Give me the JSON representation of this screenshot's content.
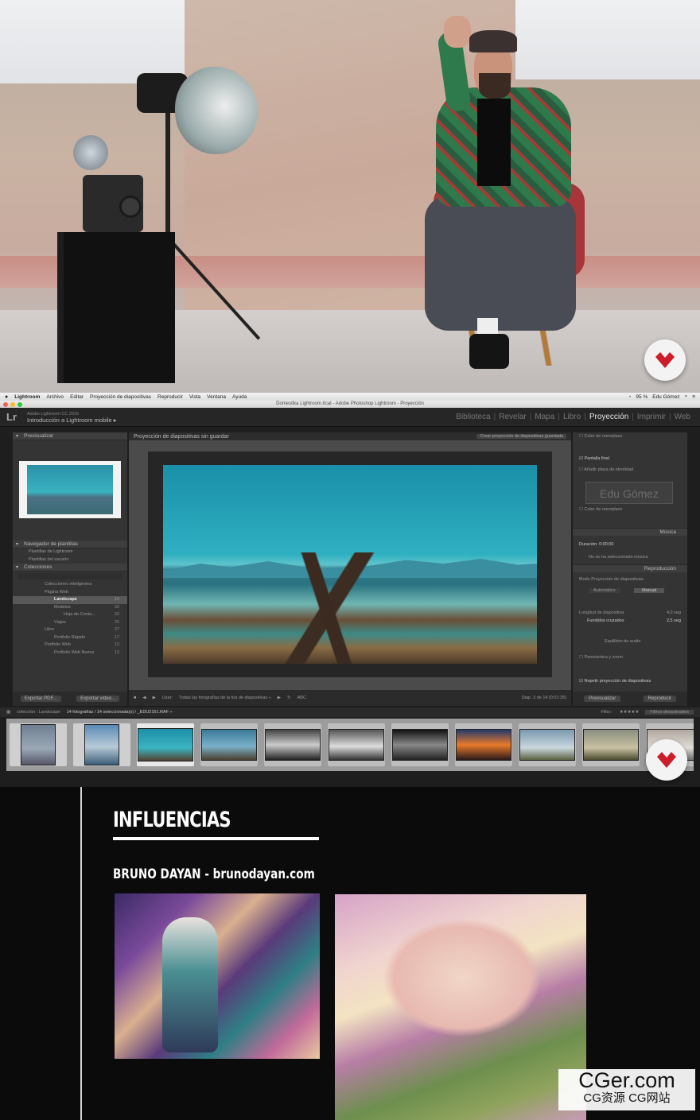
{
  "macbar": {
    "app": "Lightroom",
    "menus": [
      "Archivo",
      "Editar",
      "Proyección de diapositivas",
      "Reproducir",
      "Vista",
      "Ventana",
      "Ayuda"
    ],
    "battery": "95 %",
    "user": "Edu Gómez"
  },
  "window_title": "Domestika Lightroom.lrcat - Adobe Photoshop Lightroom - Proyección",
  "identity": {
    "product": "Adobe Lightroom CC 2015",
    "catalog": "Introducción a Lightroom mobile ▸"
  },
  "modules": [
    "Biblioteca",
    "Revelar",
    "Mapa",
    "Libro",
    "Proyección",
    "Imprimir",
    "Web"
  ],
  "active_module": "Proyección",
  "left_panel": {
    "preview_header": "Previsualizar",
    "templates_header": "Navegador de plantillas",
    "templates": [
      "Plantillas de Lightroom",
      "Plantillas del usuario"
    ],
    "collections_header": "Colecciones",
    "collections": [
      {
        "label": "Colecciones inteligentes",
        "count": ""
      },
      {
        "label": "Página Web",
        "count": ""
      },
      {
        "label": "Landscape",
        "count": "14",
        "selected": true
      },
      {
        "label": "Modelos",
        "count": "33"
      },
      {
        "label": "Hoja de Conta...",
        "count": "33"
      },
      {
        "label": "Viajes",
        "count": "20"
      },
      {
        "label": "Libro",
        "count": "37"
      },
      {
        "label": "Portfolio Rápido",
        "count": "17"
      },
      {
        "label": "Portfolio Web",
        "count": "13"
      },
      {
        "label": "Portfolio Web Nuevo",
        "count": "13"
      }
    ],
    "export_pdf": "Exportar PDF...",
    "export_video": "Exportar vídeo..."
  },
  "center": {
    "title": "Proyección de diapositivas sin guardar",
    "save_button": "Crear proyección de diapositivas guardada",
    "use_label": "Usar:",
    "use_value": "Todas las fotografías de la tira de diapositivas ÷",
    "abc": "ABC",
    "slide_counter": "Diap. 3 de 14 (0:01:35)"
  },
  "right_panel": {
    "color_reemplazo": "Color de reemplazo",
    "pantalla_final": "Pantalla final",
    "anadir_placa": "Añadir placa de identidad",
    "identity_plate": "Edu Gómez",
    "color_reemplazo_2": "Color de reemplazo",
    "musica_header": "Música",
    "duracion": "Duración: 0:00:00",
    "no_musica": "No se ha seleccionado música",
    "reproduccion_header": "Reproducción",
    "modo": "Modo Proyección de diapositivas:",
    "automatico": "Automático",
    "manual": "Manual",
    "longitud_label": "Longitud de diapositiva",
    "longitud_value": "4,0 seg",
    "fundidos_label": "Fundidos cruzados",
    "fundidos_value": "2,5 seg",
    "equilibrio": "Equilibrio de audio",
    "panoramica": "Panorámica y zoom",
    "repetir": "Repetir proyección de diapositivas",
    "previsualizar": "Previsualizar",
    "reproducir": "Reproducir"
  },
  "filmstrip_bar": {
    "source": "colección : Landscape",
    "count": "14 fotografías / 14 seleccionada(s) / _EDU2161.RAF ÷",
    "filter_label": "Filtro :",
    "filter_value": "Filtros desactivados"
  },
  "presentation": {
    "title": "INFLUENCIAS",
    "subtitle": "BRUNO DAYAN - brunodayan.com"
  },
  "watermark": {
    "line1": "CGer.com",
    "line2": "CG资源 CG网站"
  },
  "colors": {
    "brand_red": "#cc1d2b",
    "lr_bg": "#1e1e1e",
    "panel": "#343434"
  }
}
